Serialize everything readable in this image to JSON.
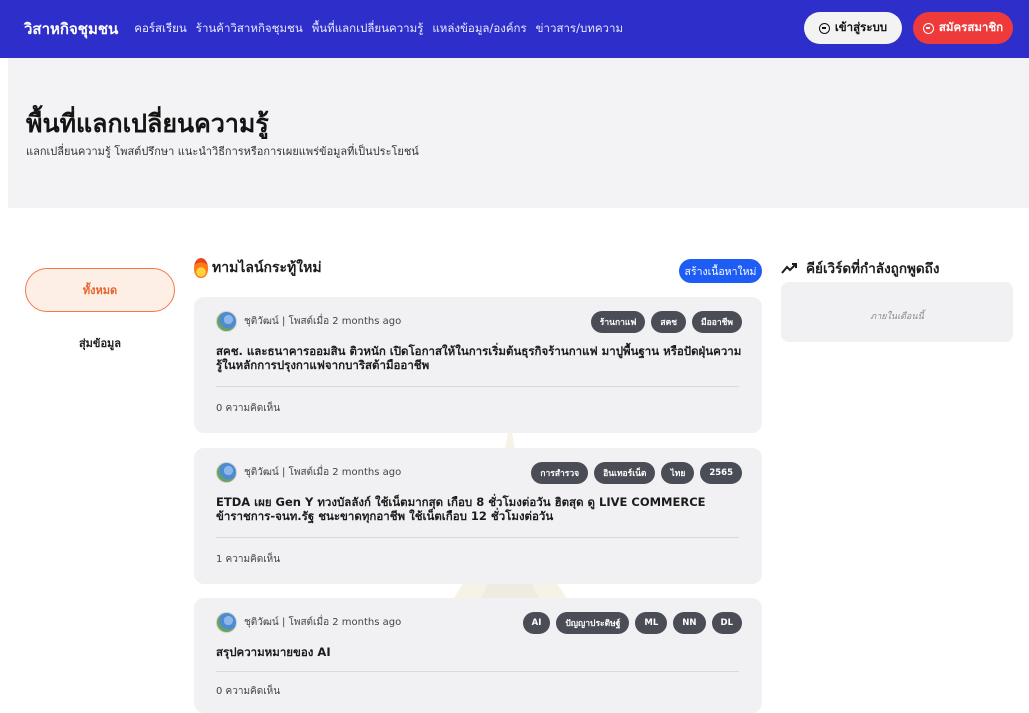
{
  "nav": {
    "brand": "วิสาหกิจชุมชน",
    "links": [
      "คอร์สเรียน",
      "ร้านค้าวิสาหกิจชุมชน",
      "พื้นที่แลกเปลี่ยนความรู้",
      "แหล่งข้อมูล/องค์กร",
      "ข่าวสาร/บทความ"
    ],
    "login_label": "เข้าสู่ระบบ",
    "register_label": "สมัครสมาชิก"
  },
  "hero": {
    "title": "พื้นที่แลกเปลี่ยนความรู้",
    "subtitle": "แลกเปลี่ยนความรู้ โพสต์ปรึกษา แนะนำวิธีการหรือการเผยแพร่ข้อมูลที่เป็นประโยชน์"
  },
  "filters": {
    "all_label": "ทั้งหมด",
    "random_label": "สุ่มข้อมูล"
  },
  "timeline": {
    "title": "ทามไลน์กระทู้ใหม่",
    "create_label": "สร้างเนื้อหาใหม่"
  },
  "posts": [
    {
      "author": "ชุติวัฒน์ | โพสต์เมื่อ 2 months ago",
      "tags": [
        "ร้านกาแฟ",
        "สคช",
        "มืออาชีพ"
      ],
      "title": "สคช. และธนาคารออมสิน ติวหนัก เปิดโอกาสให้ในการเริ่มต้นธุรกิจร้านกาแฟ มาปูพื้นฐาน หรือปัดฝุ่นความรู้ในหลักการปรุงกาแฟจากบาริสต้ามืออาชีพ",
      "comments": "0 ความคิดเห็น"
    },
    {
      "author": "ชุติวัฒน์ | โพสต์เมื่อ 2 months ago",
      "tags": [
        "การสำรวจ",
        "อินเทอร์เน็ต",
        "ไทย",
        "2565"
      ],
      "title": "ETDA เผย Gen Y ทวงบัลลังก์ ใช้เน็ตมากสุด เกือบ 8 ชั่วโมงต่อวัน ฮิตสุด ดู LIVE COMMERCE ข้าราชการ-จนท.รัฐ ชนะขาดทุกอาชีพ ใช้เน็ตเกือบ 12 ชั่วโมงต่อวัน",
      "comments": "1 ความคิดเห็น"
    },
    {
      "author": "ชุติวัฒน์ | โพสต์เมื่อ 2 months ago",
      "tags": [
        "AI",
        "ปัญญาประดิษฐ์",
        "ML",
        "NN",
        "DL"
      ],
      "title": "สรุปความหมายของ AI",
      "comments": "0 ความคิดเห็น"
    }
  ],
  "keywords": {
    "title": "คีย์เวิร์ดที่กำลังถูกพูดถึง",
    "empty_text": "ภายในเดือนนี้"
  },
  "colors": {
    "nav_bg": "#2e2ecb",
    "register_bg": "#ee3a3a",
    "create_bg": "#1d5df5",
    "filter_accent": "#e8642d",
    "tag_bg": "#4a4d55"
  }
}
